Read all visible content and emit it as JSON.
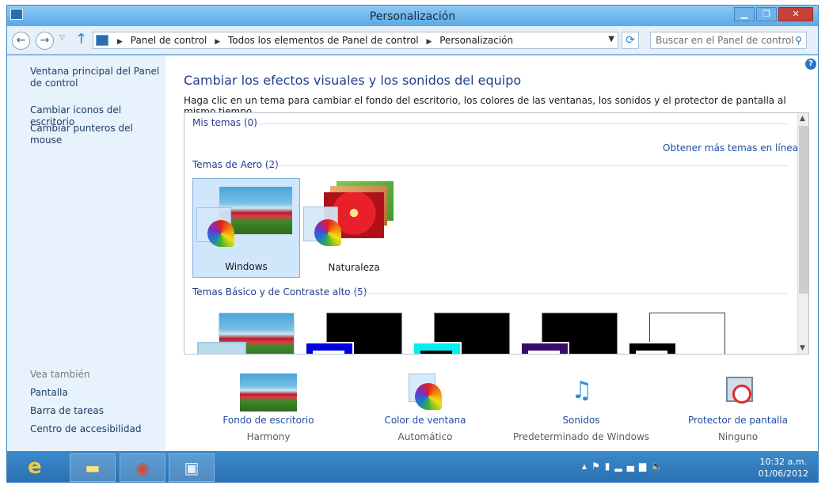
{
  "window": {
    "title": "Personalización"
  },
  "address": {
    "crumbs": [
      "Panel de control",
      "Todos los elementos de Panel de control",
      "Personalización"
    ],
    "search_placeholder": "Buscar en el Panel de control"
  },
  "sidebar": {
    "links": [
      "Ventana principal del Panel de control",
      "Cambiar iconos del escritorio",
      "Cambiar punteros del mouse"
    ],
    "see_also_heading": "Vea también",
    "see_also_links": [
      "Pantalla",
      "Barra de tareas",
      "Centro de accesibilidad"
    ]
  },
  "content": {
    "heading": "Cambiar los efectos visuales y los sonidos del equipo",
    "subtitle": "Haga clic en un tema para cambiar el fondo del escritorio, los colores de las ventanas, los sonidos y el protector de pantalla al mismo tiempo.",
    "groups": {
      "my_themes": "Mis temas (0)",
      "more_link": "Obtener más temas en línea",
      "aero": "Temas de Aero (2)",
      "basic": "Temas Básico y de Contraste alto (5)"
    },
    "aero_themes": [
      "Windows",
      "Naturaleza"
    ]
  },
  "bottom": [
    {
      "label": "Fondo de escritorio",
      "value": "Harmony",
      "icon": "desktop-background-icon"
    },
    {
      "label": "Color de ventana",
      "value": "Automático",
      "icon": "window-color-icon"
    },
    {
      "label": "Sonidos",
      "value": "Predeterminado de Windows",
      "icon": "sounds-icon"
    },
    {
      "label": "Protector de pantalla",
      "value": "Ninguno",
      "icon": "screensaver-icon"
    }
  ],
  "taskbar": {
    "time": "10:32 a.m.",
    "date": "01/06/2012"
  },
  "colors": {
    "accent": "#1e3e8c",
    "link": "#1e4ea0",
    "sidebar_bg": "#e8f2fc",
    "titlebar": "#5ba9e6"
  }
}
